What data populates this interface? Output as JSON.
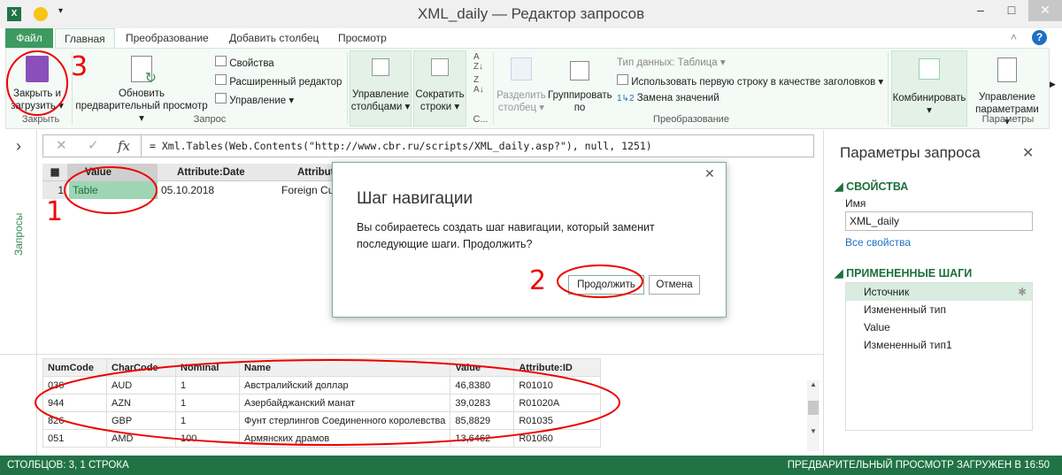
{
  "window": {
    "title": "XML_daily — Редактор запросов",
    "minimize": "–",
    "maximize": "□",
    "close": "✕"
  },
  "tabs": [
    {
      "label": "Файл"
    },
    {
      "label": "Главная"
    },
    {
      "label": "Преобразование"
    },
    {
      "label": "Добавить столбец"
    },
    {
      "label": "Просмотр"
    }
  ],
  "ribbon": {
    "close_load": "Закрыть и загрузить ▾",
    "group_close": "Закрыть",
    "refresh": "Обновить предварительный просмотр ▾",
    "properties": "Свойства",
    "advanced_editor": "Расширенный редактор",
    "manage": "Управление ▾",
    "group_query": "Запрос",
    "manage_columns": "Управление столбцами ▾",
    "reduce_rows": "Сократить строки ▾",
    "group_sort": "С...",
    "split_column": "Разделить столбец ▾",
    "group_by": "Группировать по",
    "data_type": "Тип данных: Таблица ▾",
    "use_first_row": "Использовать первую строку в качестве заголовков ▾",
    "replace_values": "Замена значений",
    "group_transform": "Преобразование",
    "combine": "Комбинировать ▾",
    "manage_params": "Управление параметрами ▾",
    "group_params": "Параметры"
  },
  "left_pane": {
    "label": "Запросы",
    "expand": "›"
  },
  "formula": {
    "cancel": "✕",
    "confirm": "✓",
    "fx": "fx",
    "text": "= Xml.Tables(Web.Contents(\"http://www.cbr.ru/scripts/XML_daily.asp?\"), null, 1251)"
  },
  "grid": {
    "headers": [
      "Value",
      "Attribute:Date",
      "Attribut"
    ],
    "row": {
      "num": "1",
      "value": "Table",
      "date": "05.10.2018",
      "attr": "Foreign Curr"
    }
  },
  "right_pane": {
    "title": "Параметры запроса",
    "properties": "СВОЙСТВА",
    "name_label": "Имя",
    "name_value": "XML_daily",
    "all_props": "Все свойства",
    "applied_steps": "ПРИМЕНЕННЫЕ ШАГИ",
    "steps": [
      "Источник",
      "Измененный тип",
      "Value",
      "Измененный тип1"
    ]
  },
  "dialog": {
    "title": "Шаг навигации",
    "message": "Вы собираетесь создать шаг навигации, который заменит последующие шаги. Продолжить?",
    "continue": "Продолжить",
    "cancel": "Отмена"
  },
  "preview": {
    "columns": [
      "NumCode",
      "CharCode",
      "Nominal",
      "Name",
      "Value",
      "Attribute:ID"
    ],
    "rows": [
      [
        "036",
        "AUD",
        "1",
        "Австралийский доллар",
        "46,8380",
        "R01010"
      ],
      [
        "944",
        "AZN",
        "1",
        "Азербайджанский манат",
        "39,0283",
        "R01020A"
      ],
      [
        "826",
        "GBP",
        "1",
        "Фунт стерлингов Соединенного королевства",
        "85,8829",
        "R01035"
      ],
      [
        "051",
        "AMD",
        "100",
        "Армянских драмов",
        "13,6462",
        "R01060"
      ]
    ]
  },
  "status": {
    "left": "СТОЛБЦОВ: 3, 1 СТРОКА",
    "right": "ПРЕДВАРИТЕЛЬНЫЙ ПРОСМОТР ЗАГРУЖЕН В 16:50"
  },
  "annotations": [
    "1",
    "2",
    "3"
  ],
  "colors": {
    "accent": "#217346",
    "file_tab": "#3d9a60",
    "selected_cell": "#9fd5b5",
    "annotation": "#e00000"
  }
}
